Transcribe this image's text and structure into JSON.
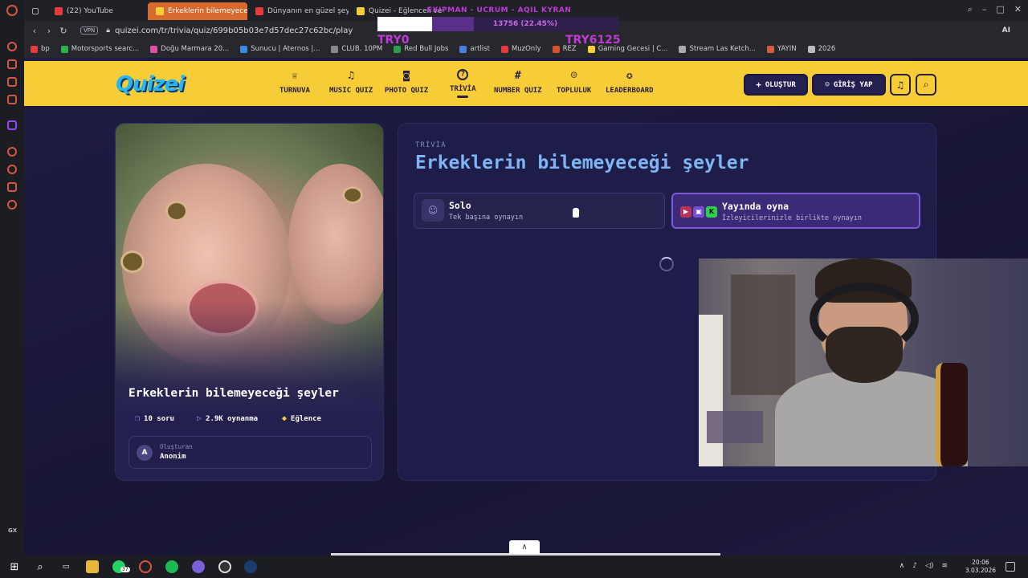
{
  "browser": {
    "tabs": [
      {
        "label": "(22) YouTube",
        "active": false
      },
      {
        "label": "Erkeklerin bilemeyeceği ş",
        "active": true
      },
      {
        "label": "Dünyanın en güzel şeyi - T",
        "active": false
      },
      {
        "label": "Quizei - Eğlenceli ve",
        "active": false
      }
    ],
    "vpn_label": "VPN",
    "url": "quizei.com/tr/trivia/quiz/699b05b03e7d57dec27c62bc/play",
    "bookmarks": [
      "bp",
      "Motorsports searc...",
      "Doğu Marmara 20...",
      "Sunucu | Aternos |...",
      "CLUB. 10PM",
      "Red Bull Jobs",
      "artlist",
      "MuzOnly",
      "REZ",
      "Gaming Gecesi | C...",
      "Stream Las Ketch...",
      "YAYIN",
      "2026"
    ],
    "ai_label": "AI"
  },
  "overlay": {
    "names": "EKIPMAN - UCRUM - AQIL KYRAN",
    "progress_text": "13756 (22.45%)",
    "progress": 0.2245,
    "left_label": "TRY0",
    "right_label": "TRY6125"
  },
  "site": {
    "logo": "Quizei",
    "nav": [
      {
        "label": "TURNUVA",
        "icon": "trophy-icon",
        "glyph": "♕"
      },
      {
        "label": "MUSIC QUIZ",
        "icon": "music-icon",
        "glyph": "♫"
      },
      {
        "label": "PHOTO QUIZ",
        "icon": "camera-icon",
        "glyph": "◙"
      },
      {
        "label": "TRİVİA",
        "icon": "question-icon",
        "glyph": "?",
        "active": true
      },
      {
        "label": "NUMBER QUIZ",
        "icon": "hash-icon",
        "glyph": "#"
      },
      {
        "label": "TOPLULUK",
        "icon": "users-icon",
        "glyph": "☺"
      },
      {
        "label": "LEADERBOARD",
        "icon": "award-icon",
        "glyph": "✪"
      }
    ],
    "create_label": "OLUŞTUR",
    "login_label": "GİRİŞ YAP"
  },
  "quiz": {
    "category": "TRİVİA",
    "title": "Erkeklerin bilemeyeceği şeyler",
    "card_title": "Erkeklerin bilemeyeceği şeyler",
    "questions": "10 soru",
    "plays": "2.9K oynanma",
    "tag": "Eğlence",
    "creator_label": "Oluşturan",
    "creator_initial": "A",
    "creator_name": "Anonim",
    "modes": {
      "solo_title": "Solo",
      "solo_sub": "Tek başına oynayın",
      "live_title": "Yayında oyna",
      "live_sub": "İzleyicilerinizle birlikte oynayın"
    }
  },
  "taskbar": {
    "whatsapp_badge": "37",
    "time": "20:06",
    "date": "3.03.2026",
    "gx": "GX"
  }
}
